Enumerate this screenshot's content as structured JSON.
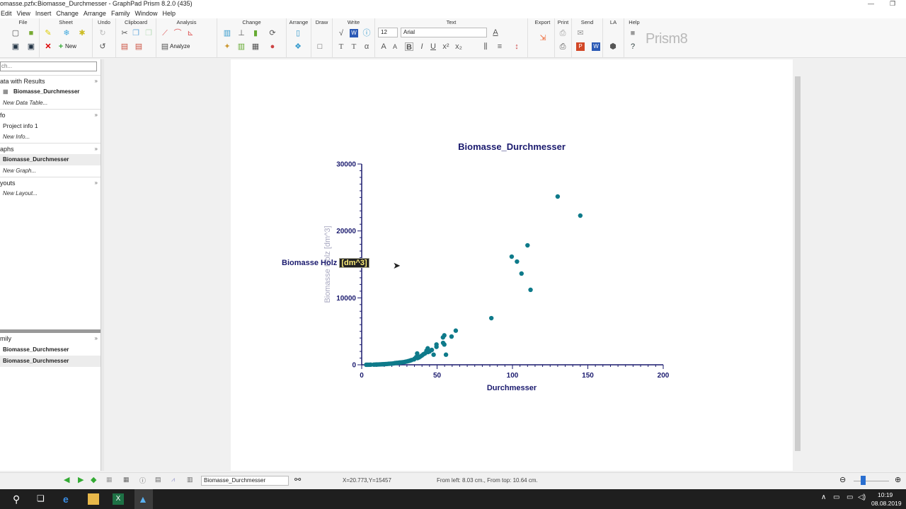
{
  "window": {
    "title": "omasse.pzfx:Biomasse_Durchmesser - GraphPad Prism 8.2.0 (435)",
    "minimize": "—",
    "restore": "❐"
  },
  "menu": [
    "Edit",
    "View",
    "Insert",
    "Change",
    "Arrange",
    "Family",
    "Window",
    "Help"
  ],
  "ribbon": {
    "groups": [
      "File",
      "Sheet",
      "Undo",
      "Clipboard",
      "Analysis",
      "Change",
      "Arrange",
      "Draw",
      "Write",
      "Text",
      "Export",
      "Print",
      "Send",
      "LA",
      "Help"
    ],
    "new_label": "New",
    "analyze_label": "Analyze",
    "font_size": "12",
    "font_name": "Arial",
    "logo_text": "Prism8",
    "logo_small": "GraphPad"
  },
  "sidebar": {
    "search_placeholder": "ch...",
    "sections": [
      {
        "title": "ata with Results",
        "items": [
          {
            "label": "Biomasse_Durchmesser",
            "style": "bold"
          },
          {
            "label": "New Data Table...",
            "style": "italic"
          }
        ]
      },
      {
        "title": "fo",
        "items": [
          {
            "label": "Project info 1",
            "style": "normal"
          },
          {
            "label": "New Info...",
            "style": "italic"
          }
        ]
      },
      {
        "title": "aphs",
        "items": [
          {
            "label": "Biomasse_Durchmesser",
            "style": "bold-selected"
          },
          {
            "label": "New Graph...",
            "style": "italic"
          }
        ]
      },
      {
        "title": "youts",
        "items": [
          {
            "label": "New Layout...",
            "style": "italic"
          }
        ]
      }
    ],
    "family": {
      "title": "mily",
      "items": [
        "Biomasse_Durchmesser",
        "Biomasse_Durchmesser"
      ]
    },
    "expand_glyph": "»"
  },
  "status": {
    "sheet_select": "Biomasse_Durchmesser",
    "coords": "X=20.773,Y=15457",
    "position": "From left: 8.03 cm., From top: 10.64 cm.",
    "zoom_level": 0.5
  },
  "taskbar": {
    "time": "10:19",
    "date": "08.08.2019"
  },
  "graph": {
    "edit_text": "Biomasse Holz ",
    "edit_selected": "[dm^3]"
  },
  "chart_data": {
    "type": "scatter",
    "title": "Biomasse_Durchmesser",
    "xlabel": "Durchmesser",
    "ylabel": "Biomasse Holz [dm^3]",
    "xlim": [
      0,
      200
    ],
    "ylim": [
      0,
      30000
    ],
    "xticks": [
      "0",
      "50",
      "100",
      "150",
      "200"
    ],
    "yticks": [
      "0",
      "10000",
      "20000",
      "30000"
    ],
    "marker_color": "#0e7a8a",
    "axis_color": "#1a1a6e",
    "grid": false,
    "points": [
      [
        130,
        25140
      ],
      [
        145,
        22290
      ],
      [
        110,
        17850
      ],
      [
        99.5,
        16160
      ],
      [
        103,
        15420
      ],
      [
        106,
        13630
      ],
      [
        112,
        11200
      ],
      [
        86,
        6970
      ],
      [
        62.4,
        5100
      ],
      [
        59.6,
        4220
      ],
      [
        54.8,
        4400
      ],
      [
        53.9,
        4090
      ],
      [
        54,
        3270
      ],
      [
        54.8,
        3030
      ],
      [
        55.9,
        1510
      ],
      [
        49.6,
        3030
      ],
      [
        49.6,
        2680
      ],
      [
        47.7,
        1510
      ],
      [
        46.5,
        2220
      ],
      [
        43.8,
        2460
      ],
      [
        43,
        2110
      ],
      [
        41,
        1580
      ],
      [
        36.8,
        1690
      ],
      [
        36.2,
        1160
      ],
      [
        34.7,
        810
      ],
      [
        37,
        1000
      ],
      [
        33,
        700
      ],
      [
        30,
        500
      ],
      [
        28,
        400
      ],
      [
        26,
        350
      ],
      [
        24,
        300
      ],
      [
        22,
        250
      ],
      [
        20,
        180
      ],
      [
        18,
        150
      ],
      [
        16,
        110
      ],
      [
        14,
        80
      ],
      [
        12,
        60
      ],
      [
        10,
        40
      ],
      [
        8,
        25
      ],
      [
        6,
        15
      ],
      [
        5,
        10
      ],
      [
        4,
        5
      ],
      [
        3,
        3
      ],
      [
        9,
        30
      ],
      [
        11,
        50
      ],
      [
        13,
        70
      ],
      [
        15,
        95
      ],
      [
        17,
        130
      ],
      [
        19,
        160
      ],
      [
        21,
        200
      ],
      [
        23,
        280
      ],
      [
        25,
        330
      ],
      [
        27,
        380
      ],
      [
        29,
        450
      ],
      [
        31,
        560
      ],
      [
        32,
        620
      ],
      [
        35,
        900
      ],
      [
        38,
        1100
      ],
      [
        39,
        1250
      ],
      [
        40,
        1400
      ],
      [
        42,
        1700
      ],
      [
        44,
        1900
      ],
      [
        45,
        2000
      ]
    ]
  }
}
